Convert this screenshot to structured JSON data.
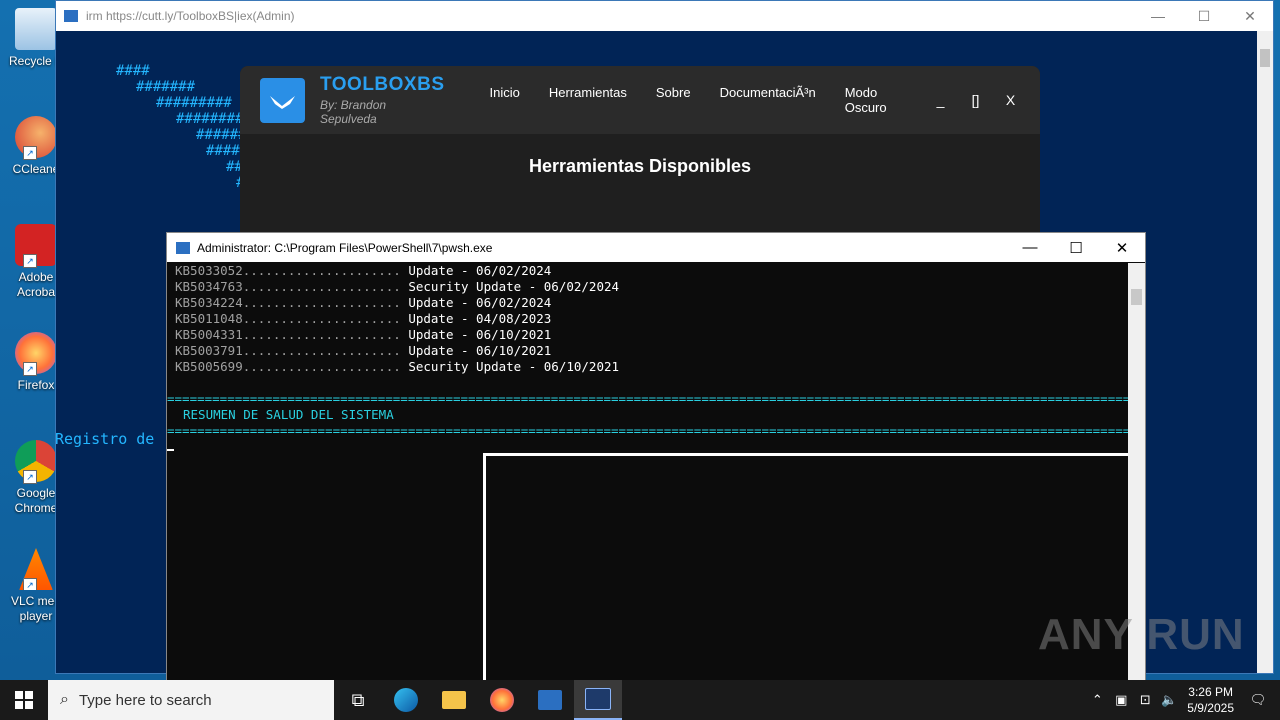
{
  "desktop": {
    "icons": [
      {
        "label": "Recycle Bin",
        "short": "Recycle E"
      },
      {
        "label": "CCleaner",
        "short": "CCleane"
      },
      {
        "label": "Adobe Acrobat",
        "short1": "Adobe",
        "short2": "Acroba"
      },
      {
        "label": "Firefox",
        "short": "Firefox"
      },
      {
        "label": "Google Chrome",
        "short1": "Google",
        "short2": "Chrome"
      },
      {
        "label": "VLC media player",
        "short1": "VLC med",
        "short2": "player"
      }
    ]
  },
  "irm_window": {
    "title": "irm https://cutt.ly/ToolboxBS|iex(Admin)",
    "ascii": [
      "####",
      "#######",
      "#########",
      "#########",
      "#########",
      "########",
      "#######",
      "######"
    ],
    "registro": "Registro de"
  },
  "toolbox": {
    "name": "TOOLBOXBS",
    "byline": "By: Brandon Sepulveda",
    "nav": [
      "Inicio",
      "Herramientas",
      "Sobre",
      "DocumentaciÃ³n",
      "Modo Oscuro"
    ],
    "controls": [
      "_",
      "[]",
      "X"
    ],
    "heading": "Herramientas Disponibles"
  },
  "pwsh": {
    "title": "Administrator: C:\\Program Files\\PowerShell\\7\\pwsh.exe",
    "updates": [
      {
        "kb": "KB5033052.....................",
        "desc": "Update - 06/02/2024"
      },
      {
        "kb": "KB5034763.....................",
        "desc": "Security Update - 06/02/2024"
      },
      {
        "kb": "KB5034224.....................",
        "desc": "Update - 06/02/2024"
      },
      {
        "kb": "KB5011048.....................",
        "desc": "Update - 04/08/2023"
      },
      {
        "kb": "KB5004331.....................",
        "desc": "Update - 06/10/2021"
      },
      {
        "kb": "KB5003791.....................",
        "desc": "Update - 06/10/2021"
      },
      {
        "kb": "KB5005699.....................",
        "desc": "Security Update - 06/10/2021"
      }
    ],
    "separator": "==========================================================================================================================================",
    "summary": "RESUMEN DE SALUD DEL SISTEMA"
  },
  "watermark": "ANY RUN",
  "taskbar": {
    "search_placeholder": "Type here to search",
    "time": "3:26 PM",
    "date": "5/9/2025"
  }
}
